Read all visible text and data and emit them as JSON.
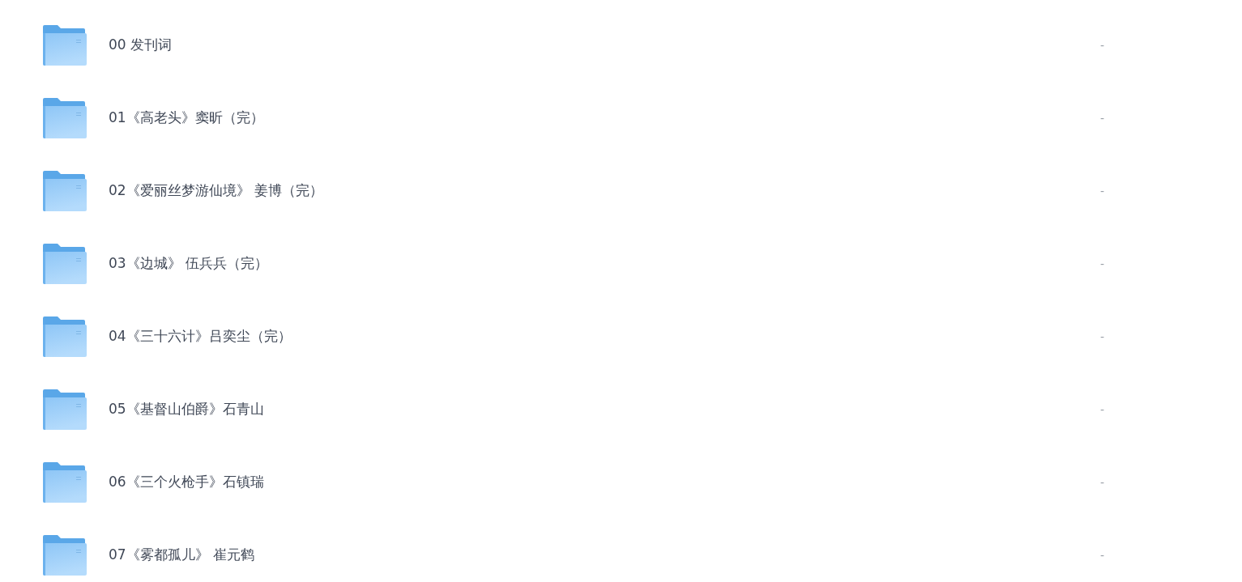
{
  "files": [
    {
      "name": "00 发刊词",
      "size": "-"
    },
    {
      "name": "01《高老头》窦昕（完）",
      "size": "-"
    },
    {
      "name": "02《爱丽丝梦游仙境》 姜博（完）",
      "size": "-"
    },
    {
      "name": "03《边城》 伍兵兵（完）",
      "size": "-"
    },
    {
      "name": "04《三十六计》吕奕尘（完）",
      "size": "-"
    },
    {
      "name": "05《基督山伯爵》石青山",
      "size": "-"
    },
    {
      "name": "06《三个火枪手》石镇瑞",
      "size": "-"
    },
    {
      "name": "07《雾都孤儿》 崔元鹤",
      "size": "-"
    }
  ]
}
